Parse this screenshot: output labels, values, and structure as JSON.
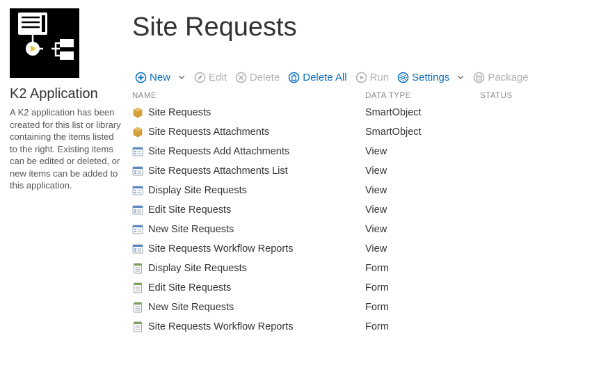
{
  "sidebar": {
    "title": "K2 Application",
    "description": "A K2 application has been created for this list or library containing the items listed to the right. Existing items can be edited or deleted, or new items can be added to this application."
  },
  "header": {
    "title": "Site Requests"
  },
  "toolbar": {
    "new_label": "New",
    "edit_label": "Edit",
    "delete_label": "Delete",
    "delete_all_label": "Delete All",
    "run_label": "Run",
    "settings_label": "Settings",
    "package_label": "Package"
  },
  "table": {
    "headers": {
      "name": "NAME",
      "data_type": "DATA TYPE",
      "status": "STATUS"
    },
    "rows": [
      {
        "icon": "smartobject",
        "name": "Site Requests",
        "type": "SmartObject",
        "status": ""
      },
      {
        "icon": "smartobject",
        "name": "Site Requests Attachments",
        "type": "SmartObject",
        "status": ""
      },
      {
        "icon": "view",
        "name": "Site Requests Add Attachments",
        "type": "View",
        "status": ""
      },
      {
        "icon": "view",
        "name": "Site Requests Attachments List",
        "type": "View",
        "status": ""
      },
      {
        "icon": "view",
        "name": "Display Site Requests",
        "type": "View",
        "status": ""
      },
      {
        "icon": "view",
        "name": "Edit Site Requests",
        "type": "View",
        "status": ""
      },
      {
        "icon": "view",
        "name": "New Site Requests",
        "type": "View",
        "status": ""
      },
      {
        "icon": "view",
        "name": "Site Requests Workflow Reports",
        "type": "View",
        "status": ""
      },
      {
        "icon": "form",
        "name": "Display Site Requests",
        "type": "Form",
        "status": ""
      },
      {
        "icon": "form",
        "name": "Edit Site Requests",
        "type": "Form",
        "status": ""
      },
      {
        "icon": "form",
        "name": "New Site Requests",
        "type": "Form",
        "status": ""
      },
      {
        "icon": "form",
        "name": "Site Requests Workflow Reports",
        "type": "Form",
        "status": ""
      }
    ]
  }
}
